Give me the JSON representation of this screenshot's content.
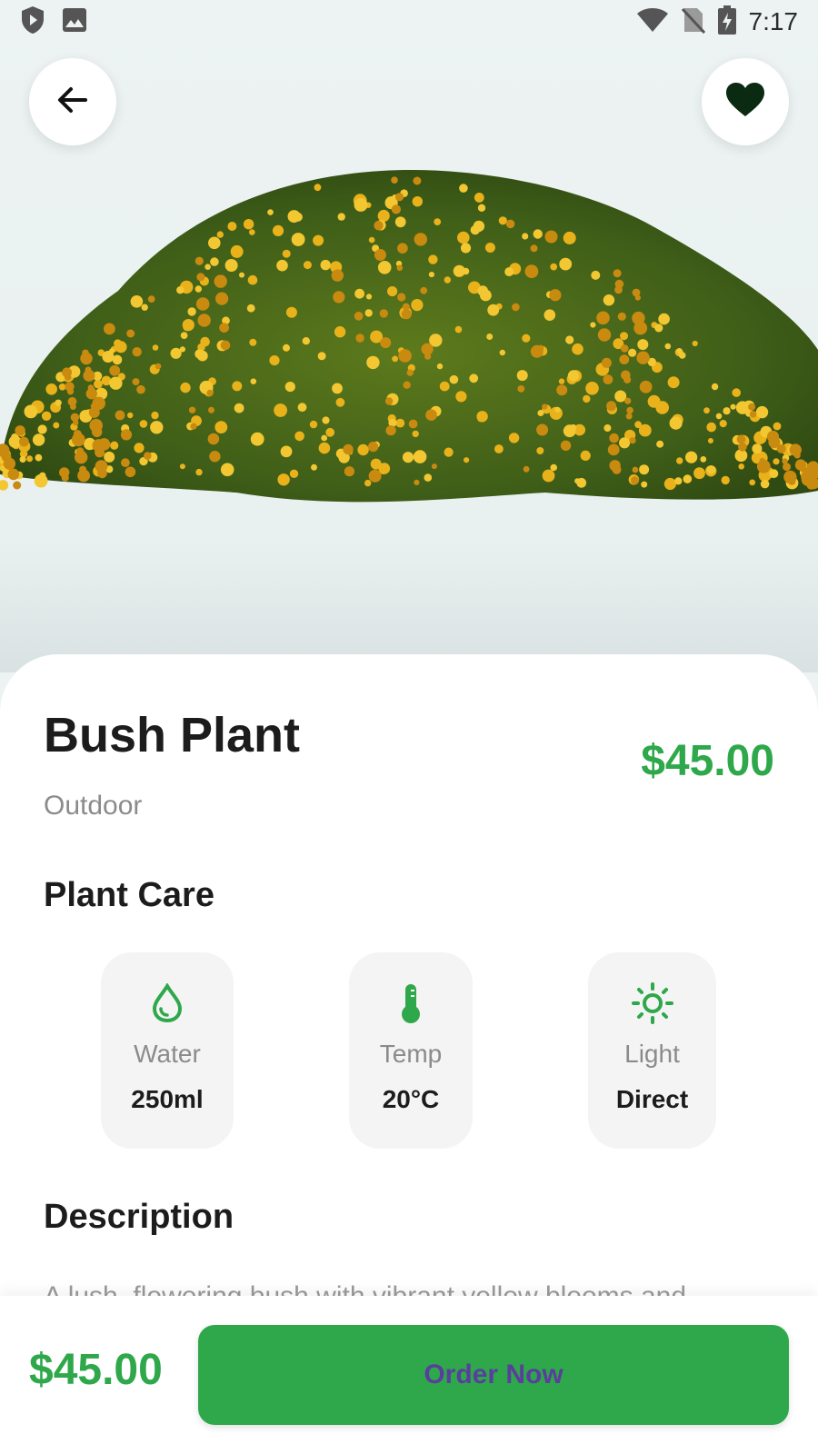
{
  "status_bar": {
    "time": "7:17",
    "left_icons": [
      "shield-play-icon",
      "image-icon"
    ],
    "right_icons": [
      "wifi-icon",
      "no-sim-icon",
      "battery-charging-icon"
    ]
  },
  "header": {
    "back_icon": "arrow-left-icon",
    "favorite_icon": "heart-icon"
  },
  "product": {
    "name": "Bush Plant",
    "category": "Outdoor",
    "price": "$45.00",
    "image": "yellow-flowering-bush"
  },
  "plant_care": {
    "heading": "Plant Care",
    "items": [
      {
        "icon": "water-drop-icon",
        "label": "Water",
        "value": "250ml"
      },
      {
        "icon": "thermometer-icon",
        "label": "Temp",
        "value": "20°C"
      },
      {
        "icon": "sun-icon",
        "label": "Light",
        "value": "Direct"
      }
    ]
  },
  "description": {
    "heading": "Description",
    "text": "A lush, flowering bush with vibrant yellow blooms and"
  },
  "bottom_bar": {
    "price": "$45.00",
    "order_label": "Order Now"
  },
  "colors": {
    "accent": "#2ea84a",
    "order_text": "#5a3e9e",
    "background": "#edf3f3"
  }
}
